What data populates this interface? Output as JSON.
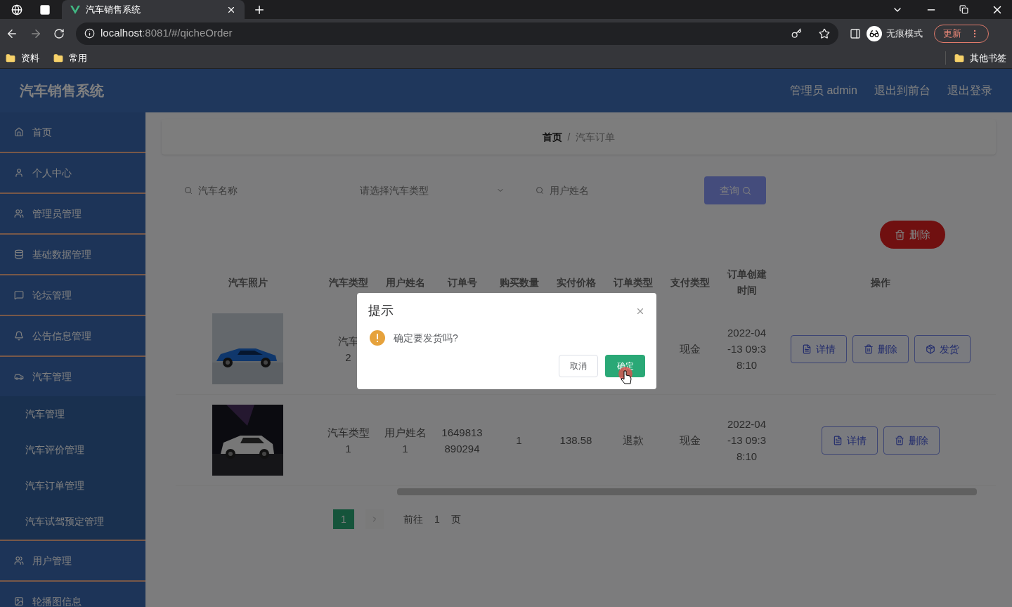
{
  "browser": {
    "tab_title": "汽车销售系统",
    "url_host": "localhost",
    "url_path": ":8081/#/qicheOrder",
    "profile": "无痕模式",
    "update": "更新",
    "bookmarks": [
      "资料",
      "常用"
    ],
    "other_bookmarks": "其他书签"
  },
  "app": {
    "title": "汽车销售系统",
    "header_links": [
      "管理员 admin",
      "退出到前台",
      "退出登录"
    ]
  },
  "sidebar": {
    "items": [
      {
        "label": "首页"
      },
      {
        "label": "个人中心"
      },
      {
        "label": "管理员管理"
      },
      {
        "label": "基础数据管理"
      },
      {
        "label": "论坛管理"
      },
      {
        "label": "公告信息管理"
      },
      {
        "label": "汽车管理",
        "expanded": true,
        "children": [
          {
            "label": "汽车管理"
          },
          {
            "label": "汽车评价管理"
          },
          {
            "label": "汽车订单管理"
          },
          {
            "label": "汽车试驾预定管理"
          }
        ]
      },
      {
        "label": "用户管理"
      },
      {
        "label": "轮播图信息"
      }
    ]
  },
  "breadcrumb": {
    "home": "首页",
    "separator": "/",
    "current": "汽车订单"
  },
  "search": {
    "fields": [
      {
        "kind": "input",
        "placeholder": "汽车名称"
      },
      {
        "kind": "select",
        "placeholder": "请选择汽车类型"
      },
      {
        "kind": "input",
        "placeholder": "用户姓名"
      }
    ],
    "button": "查询"
  },
  "delete_button": "删除",
  "table": {
    "columns": [
      "汽车照片",
      "汽车类型",
      "用户姓名",
      "订单号",
      "购买数量",
      "实付价格",
      "订单类型",
      "支付类型",
      "订单创建时间",
      "操作"
    ],
    "rows": [
      {
        "cells": [
          {
            "kind": "picture"
          },
          {
            "kind": "text",
            "lines": [
              "汽车",
              "2"
            ]
          },
          null,
          null,
          null,
          null,
          null,
          {
            "kind": "text",
            "lines": [
              "现金"
            ]
          },
          {
            "kind": "text",
            "lines": [
              "2022-04",
              "-13 09:3",
              "8:10"
            ]
          },
          {
            "kind": "actions",
            "buttons": [
              {
                "kind": "detail",
                "label": "详情"
              },
              {
                "kind": "delete",
                "label": "删除"
              },
              {
                "kind": "ship",
                "label": "发货"
              }
            ]
          }
        ]
      },
      {
        "cells": [
          {
            "kind": "picture"
          },
          {
            "kind": "text",
            "lines": [
              "汽车类型",
              "1"
            ]
          },
          {
            "kind": "text",
            "lines": [
              "用户姓名",
              "1"
            ]
          },
          {
            "kind": "text",
            "lines": [
              "1649813",
              "890294"
            ]
          },
          {
            "kind": "text",
            "lines": [
              "1"
            ]
          },
          {
            "kind": "text",
            "lines": [
              "138.58"
            ]
          },
          {
            "kind": "text",
            "lines": [
              "退款"
            ]
          },
          {
            "kind": "text",
            "lines": [
              "现金"
            ]
          },
          {
            "kind": "text",
            "lines": [
              "2022-04",
              "-13 09:3",
              "8:10"
            ]
          },
          {
            "kind": "actions",
            "buttons": [
              {
                "kind": "detail",
                "label": "详情"
              },
              {
                "kind": "delete",
                "label": "删除"
              }
            ]
          }
        ]
      }
    ]
  },
  "pagination": {
    "pages": [
      {
        "label": "1",
        "selected": true
      }
    ],
    "goto": "前往",
    "goto_value": "1",
    "page_unit": "页"
  },
  "dialog": {
    "title": "提示",
    "message": "确定要发货吗?",
    "buttons": [
      {
        "kind": "cancel",
        "label": "取消"
      },
      {
        "kind": "confirm",
        "label": "确定"
      }
    ]
  }
}
